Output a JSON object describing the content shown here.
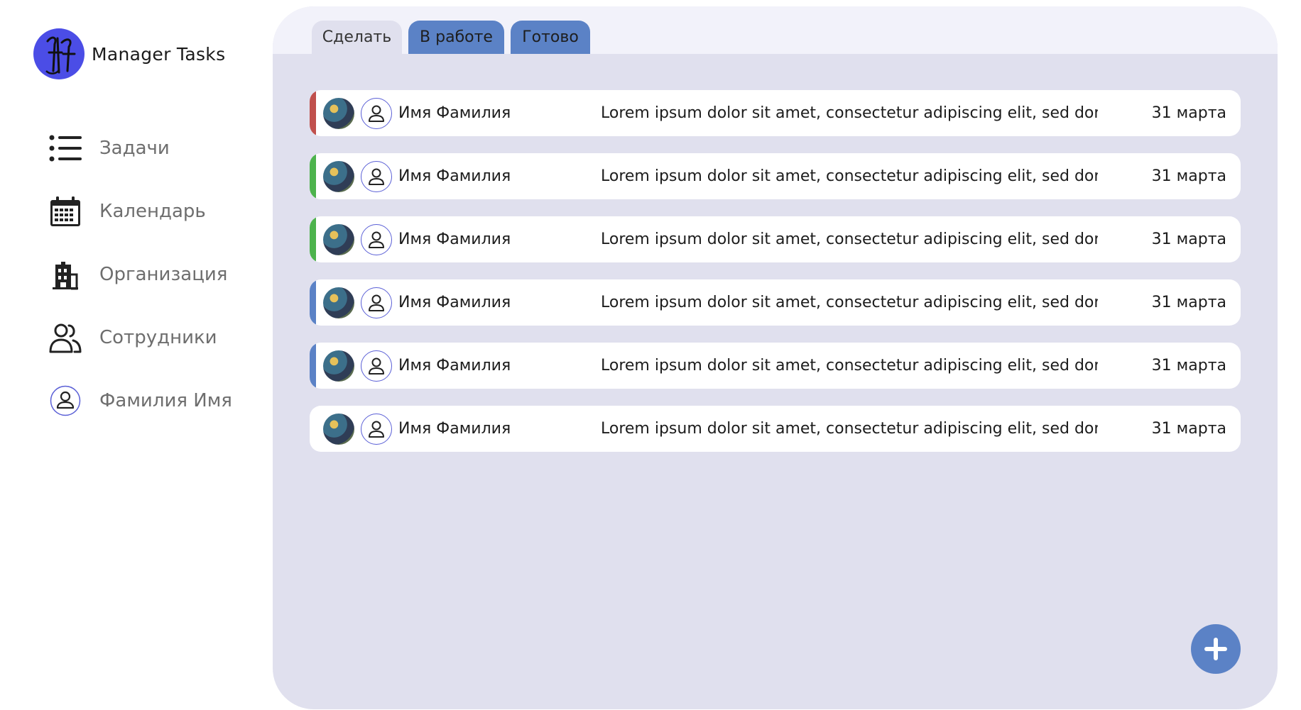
{
  "app": {
    "name": "Manager Tasks"
  },
  "sidebar": {
    "items": [
      {
        "label": "Задачи",
        "icon": "list-icon"
      },
      {
        "label": "Календарь",
        "icon": "calendar-icon"
      },
      {
        "label": "Организация",
        "icon": "building-icon"
      },
      {
        "label": "Сотрудники",
        "icon": "users-icon"
      },
      {
        "label": "Фамилия Имя",
        "icon": "user-avatar-icon"
      }
    ]
  },
  "tabs": [
    {
      "label": "Сделать",
      "active": true
    },
    {
      "label": "В работе",
      "active": false
    },
    {
      "label": "Готово",
      "active": false
    }
  ],
  "colors": {
    "accent": "#5b82c6",
    "panel_bg": "#e0e0ee",
    "logo": "#4b4de6",
    "priority_red": "#c0504d",
    "priority_green": "#4db34d",
    "priority_blue": "#5b82c6"
  },
  "tasks": [
    {
      "assignee": "Имя Фамилия",
      "description": "Lorem ipsum dolor sit amet, consectetur adipiscing elit, sed don...",
      "due": "31 марта",
      "priority_color": "#c0504d"
    },
    {
      "assignee": "Имя Фамилия",
      "description": "Lorem ipsum dolor sit amet, consectetur adipiscing elit, sed don...",
      "due": "31 марта",
      "priority_color": "#4db34d"
    },
    {
      "assignee": "Имя Фамилия",
      "description": "Lorem ipsum dolor sit amet, consectetur adipiscing elit, sed don...",
      "due": "31 марта",
      "priority_color": "#4db34d"
    },
    {
      "assignee": "Имя Фамилия",
      "description": "Lorem ipsum dolor sit amet, consectetur adipiscing elit, sed don...",
      "due": "31 марта",
      "priority_color": "#5b82c6"
    },
    {
      "assignee": "Имя Фамилия",
      "description": "Lorem ipsum dolor sit amet, consectetur adipiscing elit, sed don...",
      "due": "31 марта",
      "priority_color": "#5b82c6"
    },
    {
      "assignee": "Имя Фамилия",
      "description": "Lorem ipsum dolor sit amet, consectetur adipiscing elit, sed don...",
      "due": "31 марта",
      "priority_color": ""
    }
  ],
  "add_button": {
    "icon": "plus-icon"
  }
}
